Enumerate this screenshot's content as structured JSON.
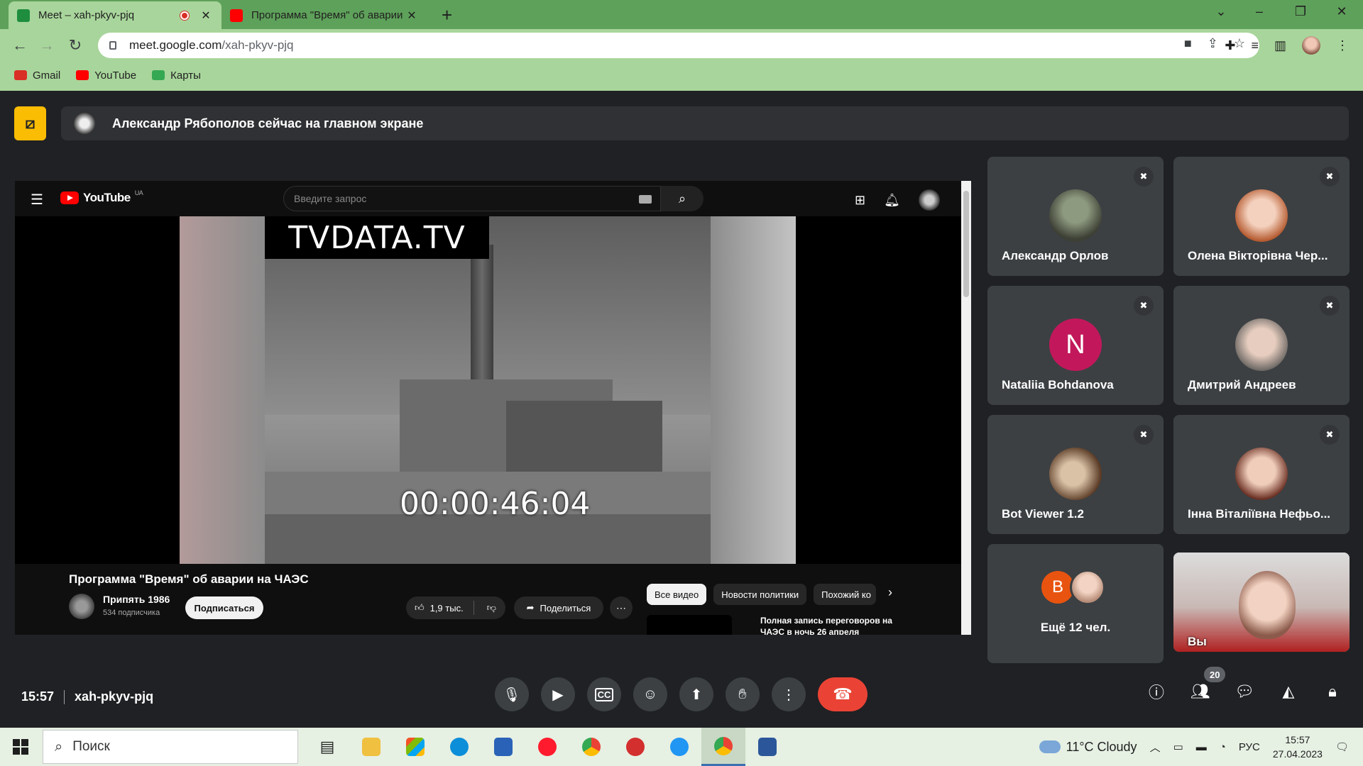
{
  "browser": {
    "tabs": [
      {
        "title": "Meet – xah-pkyv-pjq",
        "favicon_color": "#1e8e3e",
        "recording": true
      },
      {
        "title": "Программа \"Время\" об аварии",
        "favicon_color": "#ff0000",
        "recording": false
      }
    ],
    "url_host": "meet.google.com",
    "url_path": "/xah-pkyv-pjq",
    "bookmarks": [
      {
        "label": "Gmail",
        "color": "#d93025"
      },
      {
        "label": "YouTube",
        "color": "#ff0000"
      },
      {
        "label": "Карты",
        "color": "#34a853"
      }
    ],
    "frame_color": "#a8d59b",
    "tabbar_color": "#5ea15a"
  },
  "meet": {
    "presenting_banner": "Александр Рябополов сейчас на главном экране",
    "accent_presenting": "#fbbc04",
    "time": "15:57",
    "meeting_code": "xah-pkyv-pjq",
    "participant_count": "20",
    "participants": [
      {
        "name": "Александр Орлов",
        "avatar": "photo",
        "muted": true
      },
      {
        "name": "Олена Вікторівна Чер...",
        "avatar": "photo",
        "muted": true
      },
      {
        "name": "Nataliia Bohdanova",
        "avatar": "letter",
        "letter": "N",
        "color": "#c2185b",
        "muted": true
      },
      {
        "name": "Дмитрий Андреев",
        "avatar": "photo",
        "muted": true
      },
      {
        "name": "Bot Viewer 1.2",
        "avatar": "photo",
        "muted": true
      },
      {
        "name": "Інна Віталіївна Нефьо...",
        "avatar": "photo",
        "muted": true
      }
    ],
    "more": {
      "letter": "B",
      "label": "Ещё 12 чел."
    },
    "self_label": "Вы",
    "end_call_color": "#ea4335"
  },
  "youtube": {
    "region": "UA",
    "logo_text": "YouTube",
    "search_placeholder": "Введите запрос",
    "video_watermark": "TVDATA.TV",
    "video_timecode": "00:00:46:04",
    "video_title": "Программа \"Время\" об аварии на ЧАЭС",
    "channel_name": "Припять 1986",
    "channel_subs": "534 подписчика",
    "subscribe_label": "Подписаться",
    "likes": "1,9 тыс.",
    "share_label": "Поделиться",
    "chips": [
      "Все видео",
      "Новости политики",
      "Похожий ко"
    ],
    "rec_title": "Полная запись переговоров на ЧАЭС в ночь 26 апреля"
  },
  "taskbar": {
    "search_placeholder": "Поиск",
    "weather": "11°C  Cloudy",
    "lang": "РУС",
    "time": "15:57",
    "date": "27.04.2023"
  }
}
